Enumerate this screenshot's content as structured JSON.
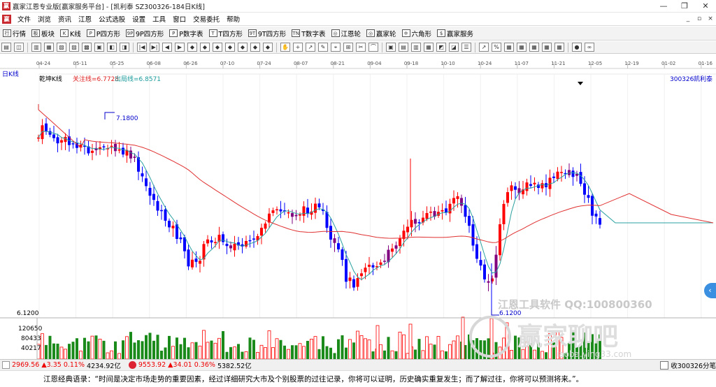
{
  "title": "赢家江恩专业版[赢家服务平台] - [凯利泰    SZ300326-184日K线]",
  "window_buttons": [
    "—",
    "❐",
    "✕"
  ],
  "menu": [
    "文件",
    "浏览",
    "资讯",
    "江恩",
    "公式选股",
    "设置",
    "工具",
    "窗口",
    "交易委托",
    "帮助"
  ],
  "toolbar1": [
    {
      "icon": "行",
      "label": "行情"
    },
    {
      "icon": "板",
      "label": "板块"
    },
    {
      "icon": "K",
      "label": "K线"
    },
    {
      "icon": "P",
      "label": "P四方形"
    },
    {
      "icon": "9P",
      "label": "9P四方形"
    },
    {
      "icon": "P",
      "label": "P数字表"
    },
    {
      "icon": "T",
      "label": "T四方形"
    },
    {
      "icon": "9T",
      "label": "9T四方形"
    },
    {
      "icon": "TN",
      "label": "T数字表"
    },
    {
      "icon": "◎",
      "label": "江恩轮"
    },
    {
      "icon": "◎",
      "label": "赢家轮"
    },
    {
      "icon": "✡",
      "label": "六角形"
    },
    {
      "icon": "$",
      "label": "赢家服务"
    }
  ],
  "toolbar2_icons": [
    "▤",
    "◫",
    "▥",
    "▦",
    "▧",
    "▨",
    "▩",
    "▣",
    "◧",
    "◨",
    "|◀",
    "▶|",
    "◀",
    "▶",
    "◆",
    "◆",
    "◆",
    "◆",
    "◆",
    "◆",
    "◆",
    "✋",
    "+",
    "↗",
    "✎",
    "⌖",
    "⊞",
    "✂",
    "⌒",
    "▣",
    "▤",
    "▥",
    "▦",
    "◩",
    "◪",
    "☰",
    "↗",
    "%",
    "▦",
    "▦",
    "▦",
    "▦",
    "▦",
    "●",
    "∞"
  ],
  "chart": {
    "period_label": "日K线",
    "indicator_label": "乾坤K线",
    "focus_line_label": "关注线=6.7728",
    "exit_line_label": "出局线=6.8571",
    "stock_code": "300326",
    "stock_name": "凯利泰",
    "high_label": "7.1800",
    "low_label": "6.1200",
    "price_axis_label": "6.1200",
    "volume_axis": [
      "120650",
      "80433",
      "40217"
    ],
    "date_ticks": [
      "04-24",
      "05-11",
      "05-25",
      "06-08",
      "06-26",
      "07-10",
      "07-24",
      "08-07",
      "08-21",
      "09-04",
      "09-18",
      "10-10",
      "10-24",
      "11-07",
      "11-21",
      "12-05",
      "12-19",
      "01-02",
      "01-16"
    ],
    "watermark_tool": "江恩工具软件  QQ:100800360",
    "watermark_site": "赢家聊吧",
    "watermark_url": "iaoba.ying33.com"
  },
  "chart_data": {
    "type": "candlestick",
    "title": "凯利泰 300326 日K线",
    "x": [
      "04-24",
      "05-11",
      "05-25",
      "06-08",
      "06-26",
      "07-10",
      "07-24",
      "08-07",
      "08-21",
      "09-04",
      "09-18",
      "10-10",
      "10-24",
      "11-07",
      "11-21",
      "12-05",
      "12-19",
      "01-02",
      "01-16"
    ],
    "series": [
      {
        "name": "关注线",
        "last": 6.7728
      },
      {
        "name": "出局线",
        "last": 6.8571
      }
    ],
    "annotations": [
      {
        "label": "7.1800",
        "kind": "high"
      },
      {
        "label": "6.1200",
        "kind": "low"
      }
    ],
    "volume_ticks": [
      120650,
      80433,
      40217
    ]
  },
  "status": {
    "sh_value": "2969.56",
    "sh_change": "▲3.35",
    "sh_pct": "0.11%",
    "sh_amount": "4234.92亿",
    "sz_value": "9553.92",
    "sz_change": "▲34.01",
    "sz_pct": "0.36%",
    "sz_amount": "5382.52亿",
    "right_text": "收300326分笔"
  },
  "quote": "江恩经典语录：“时间是决定市场走势的重要因素，经过详细研究大市及个别股票的过往记录，你将可以证明，历史确实重复发生；而了解过往，你将可以预测将来。”。",
  "colors": {
    "up": "#ff0000",
    "down": "#0000ff",
    "neutral": "#800080",
    "ma_red": "#e03030",
    "ma_teal": "#2aa0a0",
    "vol_green": "#1a8a1a"
  }
}
